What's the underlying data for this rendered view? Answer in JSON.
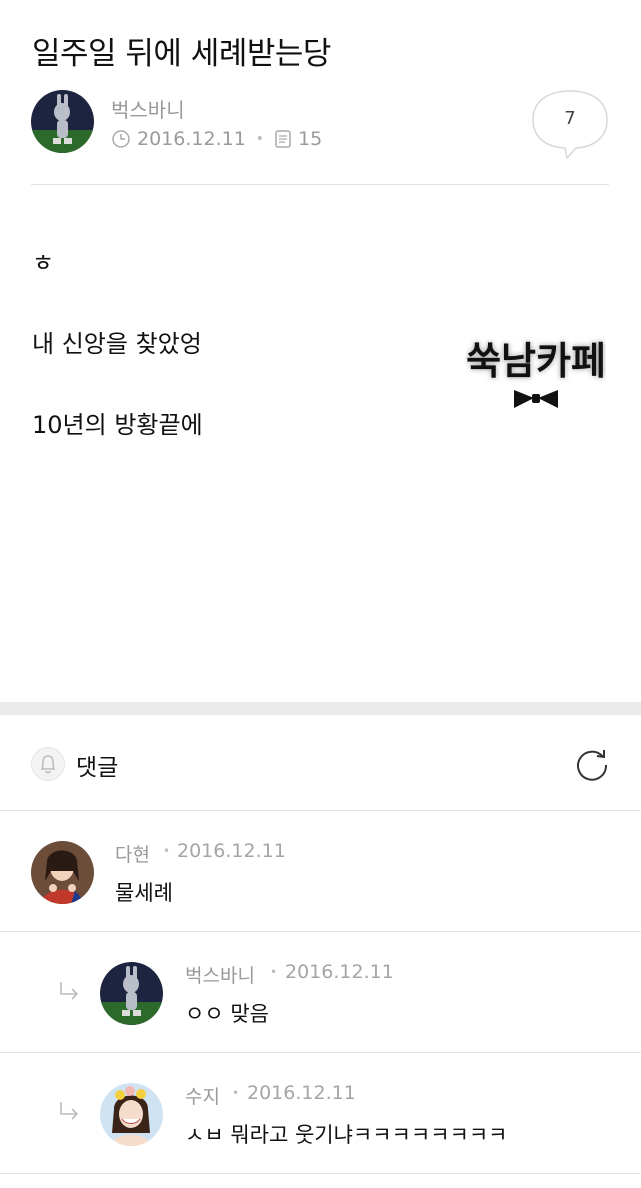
{
  "post": {
    "title": "일주일 뒤에 세례받는당",
    "author": "벅스바니",
    "date": "2016.12.11",
    "views": "15",
    "comment_count": "7",
    "lines": [
      "ㅎ",
      "내 신앙을 찾았엉",
      "10년의 방황끝에"
    ],
    "logo_text": "쑥남카페"
  },
  "comments": {
    "label": "댓글",
    "items": [
      {
        "author": "다현",
        "date": "2016.12.11",
        "text": "물세례"
      },
      {
        "author": "벅스바니",
        "date": "2016.12.11",
        "text": "ㅇㅇ 맞음"
      },
      {
        "author": "수지",
        "date": "2016.12.11",
        "text": "ㅅㅂ 뭐라고 웃기냐ㅋㅋㅋㅋㅋㅋㅋㅋ"
      }
    ]
  }
}
